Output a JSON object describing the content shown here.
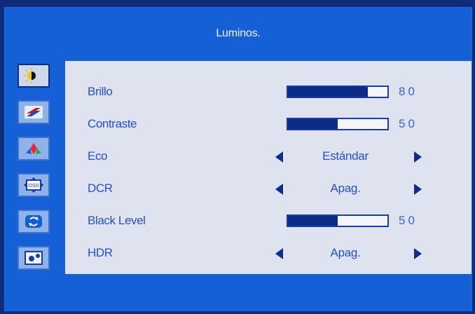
{
  "title": "Luminos.",
  "sidebar": {
    "items": [
      {
        "icon": "brightness-icon",
        "active": true
      },
      {
        "icon": "image-setup-icon",
        "active": false
      },
      {
        "icon": "color-temp-icon",
        "active": false
      },
      {
        "icon": "osd-setup-icon",
        "active": false
      },
      {
        "icon": "reset-icon",
        "active": false
      },
      {
        "icon": "extra-icon",
        "active": false
      }
    ]
  },
  "settings": [
    {
      "label": "Brillo",
      "type": "slider",
      "value": 80,
      "value_text": "80"
    },
    {
      "label": "Contraste",
      "type": "slider",
      "value": 50,
      "value_text": "50"
    },
    {
      "label": "Eco",
      "type": "option",
      "value_text": "Estándar"
    },
    {
      "label": "DCR",
      "type": "option",
      "value_text": "Apag."
    },
    {
      "label": "Black Level",
      "type": "slider",
      "value": 50,
      "value_text": "50"
    },
    {
      "label": "HDR",
      "type": "option",
      "value_text": "Apag."
    }
  ],
  "colors": {
    "background": "#1560d6",
    "panel": "#dfe3ef",
    "text": "#254fc6",
    "accent": "#0a2c86"
  }
}
